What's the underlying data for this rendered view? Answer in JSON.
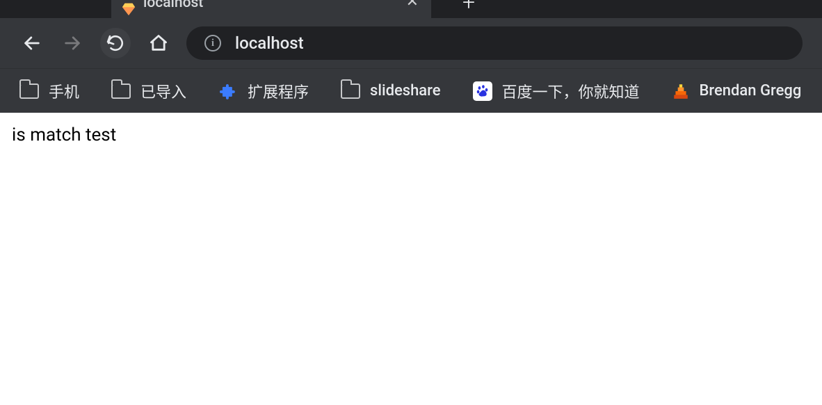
{
  "tab": {
    "title": "localhost",
    "favicon": "diamond-icon"
  },
  "address_bar": {
    "url": "localhost"
  },
  "bookmarks": [
    {
      "icon": "folder",
      "label": "手机"
    },
    {
      "icon": "folder",
      "label": "已导入"
    },
    {
      "icon": "puzzle",
      "label": "扩展程序"
    },
    {
      "icon": "folder",
      "label": "slideshare"
    },
    {
      "icon": "baidu",
      "label": "百度一下，你就知道"
    },
    {
      "icon": "flame",
      "label": "Brendan Gregg"
    }
  ],
  "page": {
    "body_text": "is match test"
  }
}
